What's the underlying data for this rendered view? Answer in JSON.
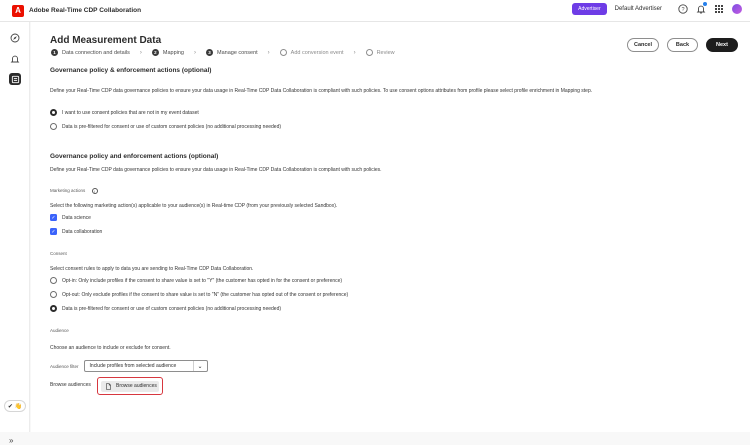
{
  "topbar": {
    "app_logo_letter": "A",
    "app_title": "Adobe Real-Time CDP Collaboration",
    "role_badge": "Advertiser",
    "org_name": "Default Advertiser",
    "icons": [
      "help-icon",
      "bell-icon",
      "apps-grid-icon",
      "avatar"
    ]
  },
  "siderail": {
    "icons": [
      "compass-icon",
      "bell-outline-icon",
      "audiences-icon"
    ],
    "ai_pill": "✔ 👋",
    "expand": "»"
  },
  "page": {
    "title": "Add Measurement Data",
    "steps": [
      {
        "num": "1",
        "label": "Data connection and details",
        "state": "done"
      },
      {
        "num": "2",
        "label": "Mapping",
        "state": "done"
      },
      {
        "num": "3",
        "label": "Manage consent",
        "state": "current"
      },
      {
        "num": "",
        "label": "Add conversion event",
        "state": "pending"
      },
      {
        "num": "",
        "label": "Review",
        "state": "pending"
      }
    ],
    "buttons": {
      "cancel": "Cancel",
      "back": "Back",
      "next": "Next"
    }
  },
  "section1": {
    "heading": "Governance policy & enforcement actions (optional)",
    "description": "Define your Real-Time CDP data governance policies to ensure your data usage in Real-Time CDP Data Collaboration is compliant with such policies. To use consent options attributes from profile please select profile enrichment in Mapping step.",
    "options": [
      {
        "label": "I want to use consent policies that are not in my event dataset",
        "checked": true
      },
      {
        "label": "Data is pre-filtered for consent or use of custom consent policies (no additional processing needed)",
        "checked": false
      }
    ]
  },
  "section2": {
    "heading": "Governance policy and enforcement actions (optional)",
    "description": "Define your Real-Time CDP data governance policies to ensure your data usage in Real-Time CDP Data Collaboration is compliant with such policies.",
    "marketing_label": "Marketing actions",
    "marketing_desc": "Select the following marketing action(s) applicable to your audience(s) in Real-time CDP (from your previously selected Sandbox).",
    "marketing_options": [
      {
        "label": "Data science",
        "checked": true
      },
      {
        "label": "Data collaboration",
        "checked": true
      }
    ],
    "consent_label": "Consent",
    "consent_desc": "Select consent rules to apply to data you are sending to Real-Time CDP Data Collaboration.",
    "consent_options": [
      {
        "label": "Opt-in: Only include profiles if the consent to share value is set to \"Y\" (the customer has opted in for the consent or preference)",
        "checked": false
      },
      {
        "label": "Opt-out: Only exclude profiles if the consent to share value is set to \"N\" (the customer has opted out of the consent or preference)",
        "checked": false
      },
      {
        "label": "Data is pre-filtered for consent or use of custom consent policies (no additional processing needed)",
        "checked": true
      }
    ],
    "audience_label": "Audience",
    "audience_desc": "Choose an audience to include or exclude for consent.",
    "filter_label": "Audience filter",
    "filter_value": "Include profiles from selected audience",
    "browse_label": "Browse audiences",
    "browse_button": "Browse audiences"
  }
}
